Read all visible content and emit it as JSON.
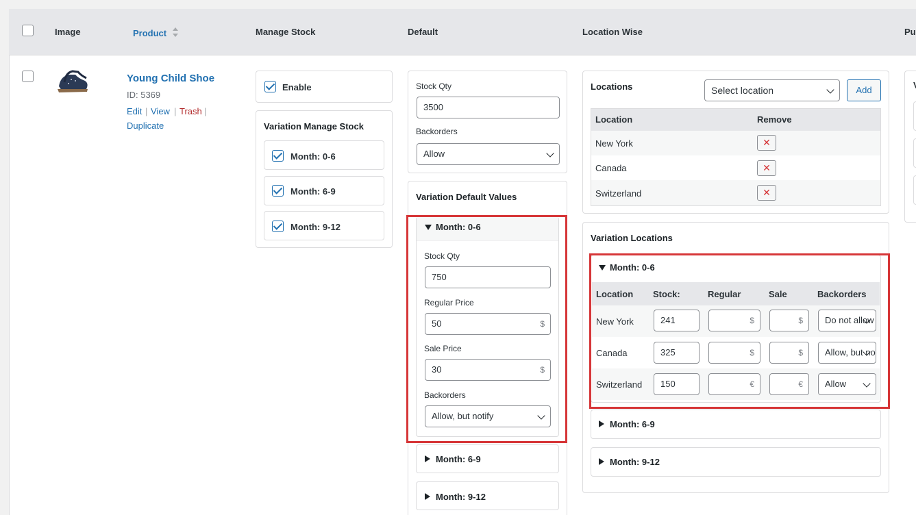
{
  "header": {
    "image": "Image",
    "product": "Product",
    "manage_stock": "Manage Stock",
    "default": "Default",
    "location_wise": "Location Wise",
    "purchase_partial": "Pu"
  },
  "product": {
    "name": "Young Child Shoe",
    "id": "ID: 5369",
    "actions": {
      "edit": "Edit",
      "view": "View",
      "trash": "Trash",
      "duplicate": "Duplicate"
    }
  },
  "manage_stock": {
    "enable_label": "Enable",
    "enabled": true,
    "variation_title": "Variation Manage Stock",
    "variations": [
      {
        "label": "Month: 0-6",
        "checked": true
      },
      {
        "label": "Month: 6-9",
        "checked": true
      },
      {
        "label": "Month: 9-12",
        "checked": true
      }
    ]
  },
  "default": {
    "stock_qty_label": "Stock Qty",
    "stock_qty": "3500",
    "backorders_label": "Backorders",
    "backorders": "Allow",
    "variation_title": "Variation Default Values",
    "expanded": {
      "label": "Month: 0-6",
      "stock_qty_label": "Stock Qty",
      "stock_qty": "750",
      "regular_label": "Regular Price",
      "regular": "50",
      "sale_label": "Sale Price",
      "sale": "30",
      "currency": "$",
      "backorders_label": "Backorders",
      "backorders": "Allow, but notify"
    },
    "collapsed": [
      "Month: 6-9",
      "Month: 9-12"
    ]
  },
  "location_wise": {
    "locations_title": "Locations",
    "select_placeholder": "Select location",
    "add_label": "Add",
    "col_location": "Location",
    "col_remove": "Remove",
    "locations": [
      "New York",
      "Canada",
      "Switzerland"
    ],
    "remove_glyph": "✕",
    "variation_title": "Variation Locations",
    "expanded": {
      "label": "Month: 0-6",
      "headers": [
        "Location",
        "Stock:",
        "Regular",
        "Sale",
        "Backorders"
      ],
      "rows": [
        {
          "location": "New York",
          "stock": "241",
          "currency": "$",
          "backorders": "Do not allow"
        },
        {
          "location": "Canada",
          "stock": "325",
          "currency": "$",
          "backorders": "Allow, but notify"
        },
        {
          "location": "Switzerland",
          "stock": "150",
          "currency": "€",
          "backorders": "Allow"
        }
      ]
    },
    "collapsed": [
      "Month: 6-9",
      "Month: 9-12"
    ]
  },
  "colors": {
    "accent": "#2271b1",
    "highlight": "#d63638",
    "header_bg": "#e6e7ea"
  }
}
